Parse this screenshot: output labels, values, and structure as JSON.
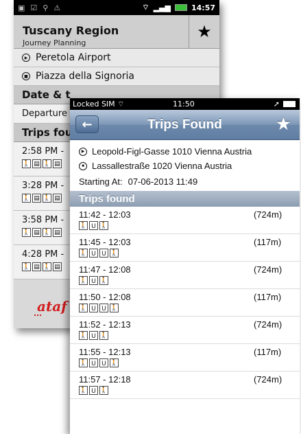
{
  "android": {
    "status": {
      "time": "14:57"
    },
    "header": {
      "title": "Tuscany Region",
      "subtitle": "Journey Planning"
    },
    "locations": [
      {
        "icon": "play-circle-icon",
        "label": "Peretola Airport"
      },
      {
        "icon": "stop-circle-icon",
        "label": "Piazza della Signoria"
      }
    ],
    "date_section": "Date & t",
    "departure": "Departure",
    "trips_section": "Trips fou",
    "trips": [
      {
        "time": "2:58 PM -",
        "modes": [
          "walk",
          "bus",
          "walk",
          "bus"
        ]
      },
      {
        "time": "3:28 PM -",
        "modes": [
          "walk",
          "bus",
          "walk",
          "bus"
        ]
      },
      {
        "time": "3:58 PM -",
        "modes": [
          "walk",
          "bus",
          "walk",
          "bus"
        ]
      },
      {
        "time": "4:28 PM -",
        "modes": [
          "walk",
          "bus",
          "walk",
          "bus"
        ]
      }
    ],
    "logo": "ataf"
  },
  "ios": {
    "status": {
      "carrier": "Locked SIM",
      "time": "11:50"
    },
    "nav": {
      "title": "Trips Found"
    },
    "from": "Leopold-Figl-Gasse 1010 Vienna Austria",
    "to": "Lassallestraße 1020 Vienna Austria",
    "starting_label": "Starting At:",
    "starting_value": "07-06-2013 11:49",
    "section": "Trips found",
    "trips": [
      {
        "time": "11:42 - 12:03",
        "distance": "(724m)",
        "modes": [
          "walk",
          "U",
          "walk"
        ]
      },
      {
        "time": "11:45 - 12:03",
        "distance": "(117m)",
        "modes": [
          "walk",
          "U",
          "U",
          "walk"
        ]
      },
      {
        "time": "11:47 - 12:08",
        "distance": "(724m)",
        "modes": [
          "walk",
          "U",
          "walk"
        ]
      },
      {
        "time": "11:50 - 12:08",
        "distance": "(117m)",
        "modes": [
          "walk",
          "U",
          "U",
          "walk"
        ]
      },
      {
        "time": "11:52 - 12:13",
        "distance": "(724m)",
        "modes": [
          "walk",
          "U",
          "walk"
        ]
      },
      {
        "time": "11:55 - 12:13",
        "distance": "(117m)",
        "modes": [
          "walk",
          "U",
          "U",
          "walk"
        ]
      },
      {
        "time": "11:57 - 12:18",
        "distance": "(724m)",
        "modes": [
          "walk",
          "U",
          "walk"
        ]
      }
    ]
  }
}
